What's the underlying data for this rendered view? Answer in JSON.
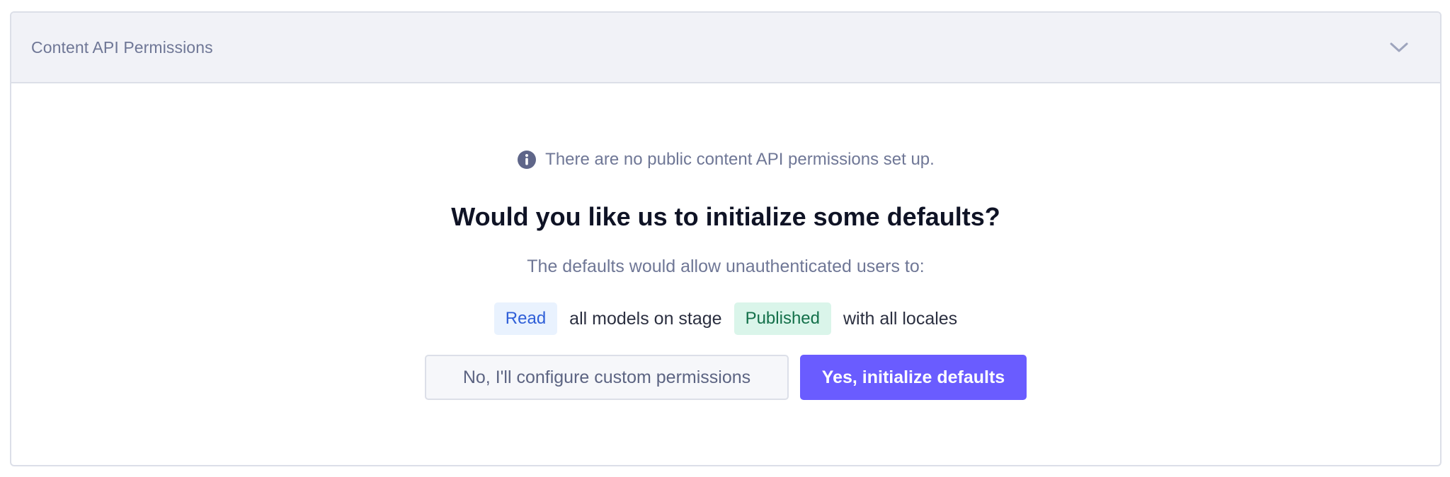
{
  "panel": {
    "title": "Content API Permissions",
    "toggle_icon": "chevron-down-icon"
  },
  "notice": {
    "icon": "info-icon",
    "text": "There are no public content API permissions set up."
  },
  "heading": "Would you like us to initialize some defaults?",
  "subtext": "The defaults would allow unauthenticated users to:",
  "rule": {
    "action_chip": "Read",
    "text_middle": "all models on stage",
    "stage_chip": "Published",
    "text_end": "with all locales"
  },
  "buttons": {
    "secondary": "No, I'll configure custom permissions",
    "primary": "Yes, initialize defaults"
  },
  "colors": {
    "accent": "#6a5cff",
    "read_chip_bg": "#e9f2fe",
    "published_chip_bg": "#daf5ea",
    "header_bg": "#f1f2f7"
  }
}
